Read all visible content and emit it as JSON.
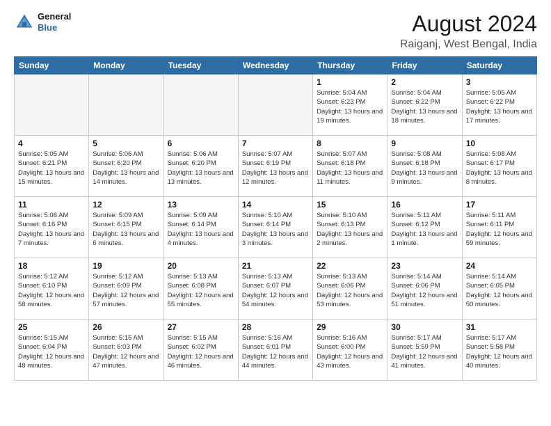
{
  "logo": {
    "line1": "General",
    "line2": "Blue"
  },
  "title": "August 2024",
  "location": "Raiganj, West Bengal, India",
  "days_of_week": [
    "Sunday",
    "Monday",
    "Tuesday",
    "Wednesday",
    "Thursday",
    "Friday",
    "Saturday"
  ],
  "weeks": [
    [
      {
        "day": "",
        "info": "",
        "empty": true
      },
      {
        "day": "",
        "info": "",
        "empty": true
      },
      {
        "day": "",
        "info": "",
        "empty": true
      },
      {
        "day": "",
        "info": "",
        "empty": true
      },
      {
        "day": "1",
        "info": "Sunrise: 5:04 AM\nSunset: 6:23 PM\nDaylight: 13 hours\nand 19 minutes.",
        "empty": false
      },
      {
        "day": "2",
        "info": "Sunrise: 5:04 AM\nSunset: 6:22 PM\nDaylight: 13 hours\nand 18 minutes.",
        "empty": false
      },
      {
        "day": "3",
        "info": "Sunrise: 5:05 AM\nSunset: 6:22 PM\nDaylight: 13 hours\nand 17 minutes.",
        "empty": false
      }
    ],
    [
      {
        "day": "4",
        "info": "Sunrise: 5:05 AM\nSunset: 6:21 PM\nDaylight: 13 hours\nand 15 minutes.",
        "empty": false
      },
      {
        "day": "5",
        "info": "Sunrise: 5:06 AM\nSunset: 6:20 PM\nDaylight: 13 hours\nand 14 minutes.",
        "empty": false
      },
      {
        "day": "6",
        "info": "Sunrise: 5:06 AM\nSunset: 6:20 PM\nDaylight: 13 hours\nand 13 minutes.",
        "empty": false
      },
      {
        "day": "7",
        "info": "Sunrise: 5:07 AM\nSunset: 6:19 PM\nDaylight: 13 hours\nand 12 minutes.",
        "empty": false
      },
      {
        "day": "8",
        "info": "Sunrise: 5:07 AM\nSunset: 6:18 PM\nDaylight: 13 hours\nand 11 minutes.",
        "empty": false
      },
      {
        "day": "9",
        "info": "Sunrise: 5:08 AM\nSunset: 6:18 PM\nDaylight: 13 hours\nand 9 minutes.",
        "empty": false
      },
      {
        "day": "10",
        "info": "Sunrise: 5:08 AM\nSunset: 6:17 PM\nDaylight: 13 hours\nand 8 minutes.",
        "empty": false
      }
    ],
    [
      {
        "day": "11",
        "info": "Sunrise: 5:08 AM\nSunset: 6:16 PM\nDaylight: 13 hours\nand 7 minutes.",
        "empty": false
      },
      {
        "day": "12",
        "info": "Sunrise: 5:09 AM\nSunset: 6:15 PM\nDaylight: 13 hours\nand 6 minutes.",
        "empty": false
      },
      {
        "day": "13",
        "info": "Sunrise: 5:09 AM\nSunset: 6:14 PM\nDaylight: 13 hours\nand 4 minutes.",
        "empty": false
      },
      {
        "day": "14",
        "info": "Sunrise: 5:10 AM\nSunset: 6:14 PM\nDaylight: 13 hours\nand 3 minutes.",
        "empty": false
      },
      {
        "day": "15",
        "info": "Sunrise: 5:10 AM\nSunset: 6:13 PM\nDaylight: 13 hours\nand 2 minutes.",
        "empty": false
      },
      {
        "day": "16",
        "info": "Sunrise: 5:11 AM\nSunset: 6:12 PM\nDaylight: 13 hours\nand 1 minute.",
        "empty": false
      },
      {
        "day": "17",
        "info": "Sunrise: 5:11 AM\nSunset: 6:11 PM\nDaylight: 12 hours\nand 59 minutes.",
        "empty": false
      }
    ],
    [
      {
        "day": "18",
        "info": "Sunrise: 5:12 AM\nSunset: 6:10 PM\nDaylight: 12 hours\nand 58 minutes.",
        "empty": false
      },
      {
        "day": "19",
        "info": "Sunrise: 5:12 AM\nSunset: 6:09 PM\nDaylight: 12 hours\nand 57 minutes.",
        "empty": false
      },
      {
        "day": "20",
        "info": "Sunrise: 5:13 AM\nSunset: 6:08 PM\nDaylight: 12 hours\nand 55 minutes.",
        "empty": false
      },
      {
        "day": "21",
        "info": "Sunrise: 5:13 AM\nSunset: 6:07 PM\nDaylight: 12 hours\nand 54 minutes.",
        "empty": false
      },
      {
        "day": "22",
        "info": "Sunrise: 5:13 AM\nSunset: 6:06 PM\nDaylight: 12 hours\nand 53 minutes.",
        "empty": false
      },
      {
        "day": "23",
        "info": "Sunrise: 5:14 AM\nSunset: 6:06 PM\nDaylight: 12 hours\nand 51 minutes.",
        "empty": false
      },
      {
        "day": "24",
        "info": "Sunrise: 5:14 AM\nSunset: 6:05 PM\nDaylight: 12 hours\nand 50 minutes.",
        "empty": false
      }
    ],
    [
      {
        "day": "25",
        "info": "Sunrise: 5:15 AM\nSunset: 6:04 PM\nDaylight: 12 hours\nand 48 minutes.",
        "empty": false
      },
      {
        "day": "26",
        "info": "Sunrise: 5:15 AM\nSunset: 6:03 PM\nDaylight: 12 hours\nand 47 minutes.",
        "empty": false
      },
      {
        "day": "27",
        "info": "Sunrise: 5:15 AM\nSunset: 6:02 PM\nDaylight: 12 hours\nand 46 minutes.",
        "empty": false
      },
      {
        "day": "28",
        "info": "Sunrise: 5:16 AM\nSunset: 6:01 PM\nDaylight: 12 hours\nand 44 minutes.",
        "empty": false
      },
      {
        "day": "29",
        "info": "Sunrise: 5:16 AM\nSunset: 6:00 PM\nDaylight: 12 hours\nand 43 minutes.",
        "empty": false
      },
      {
        "day": "30",
        "info": "Sunrise: 5:17 AM\nSunset: 5:59 PM\nDaylight: 12 hours\nand 41 minutes.",
        "empty": false
      },
      {
        "day": "31",
        "info": "Sunrise: 5:17 AM\nSunset: 5:58 PM\nDaylight: 12 hours\nand 40 minutes.",
        "empty": false
      }
    ]
  ]
}
